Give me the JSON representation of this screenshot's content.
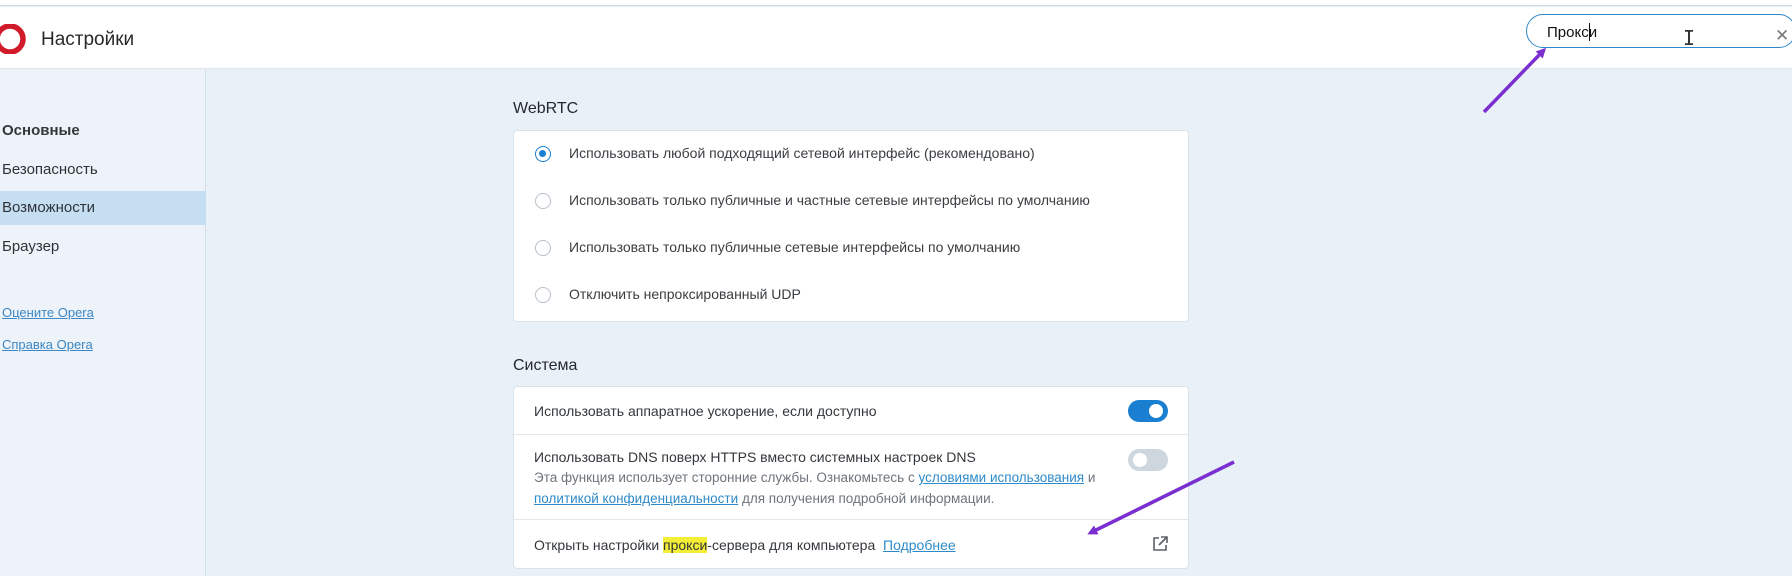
{
  "header": {
    "title": "Настройки",
    "search_value": "Прокси"
  },
  "sidebar": {
    "items": [
      {
        "label": "Основные"
      },
      {
        "label": "Безопасность"
      },
      {
        "label": "Возможности"
      },
      {
        "label": "Браузер"
      }
    ],
    "links": [
      {
        "label": "Оцените Opera"
      },
      {
        "label": "Справка Opera"
      }
    ]
  },
  "webrtc": {
    "title": "WebRTC",
    "options": [
      {
        "label": "Использовать любой подходящий сетевой интерфейс (рекомендовано)",
        "checked": true
      },
      {
        "label": "Использовать только публичные и частные сетевые интерфейсы по умолчанию",
        "checked": false
      },
      {
        "label": "Использовать только публичные сетевые интерфейсы по умолчанию",
        "checked": false
      },
      {
        "label": "Отключить непроксированный UDP",
        "checked": false
      }
    ]
  },
  "system": {
    "title": "Система",
    "hw_accel": {
      "label": "Использовать аппаратное ускорение, если доступно",
      "enabled": true
    },
    "dns": {
      "label": "Использовать DNS поверх HTTPS вместо системных настроек DNS",
      "desc_1": "Эта функция использует сторонние службы. Ознакомьтесь с",
      "link_1": "условиями использования",
      "desc_2": "и",
      "link_2": "политикой конфиденциальности",
      "desc_3": "для получения подробной информации.",
      "enabled": false
    },
    "proxy": {
      "label_before": "Открыть настройки",
      "label_highlight": "прокси",
      "label_after": "-сервера для компьютера",
      "link": "Подробнее"
    }
  },
  "colors": {
    "accent": "#1b7fd1",
    "arrow": "#7b2fd0",
    "highlight": "#f4ef36",
    "logo": "#d11a2a"
  },
  "icons": {
    "logo": "opera-logo-icon",
    "clear": "close-icon",
    "external": "external-link-icon"
  }
}
